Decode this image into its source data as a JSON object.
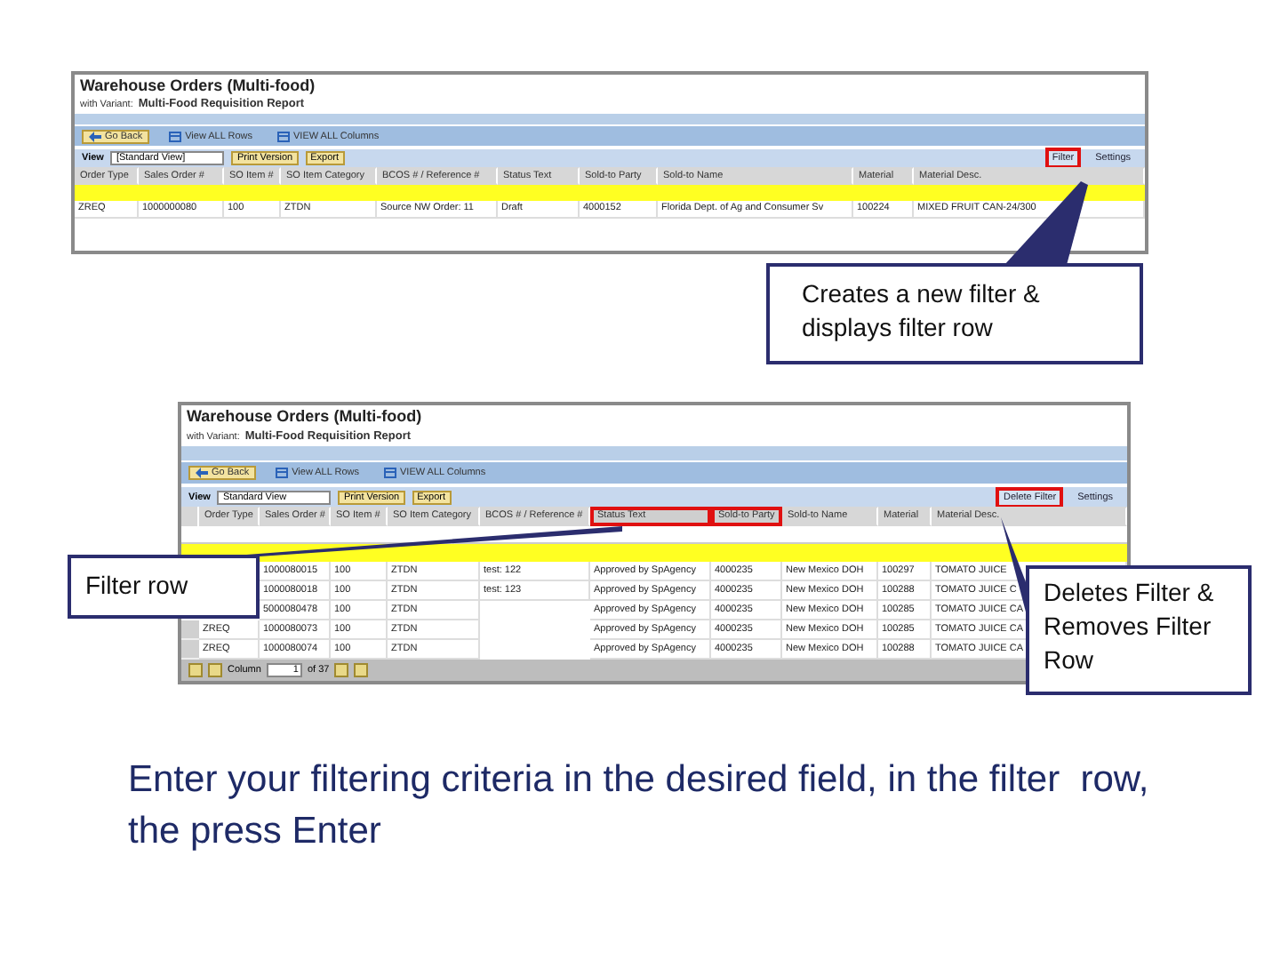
{
  "screenshots": [
    {
      "title": "Warehouse Orders (Multi-food)",
      "variant_label": "with Variant:",
      "variant": "Multi-Food Requisition Report",
      "toolbar": [
        "Go Back",
        "View ALL Rows",
        "VIEW ALL Columns"
      ],
      "view_label": "View",
      "view_value": "[Standard View]",
      "buttons": [
        "Print Version",
        "Export"
      ],
      "links": [
        {
          "label": "Filter",
          "highlighted": true
        },
        {
          "label": "Settings",
          "highlighted": false
        }
      ],
      "filter_row": false,
      "selector_column": false,
      "columns": [
        {
          "label": "Order Type",
          "highlighted": false
        },
        {
          "label": "Sales Order #",
          "highlighted": false
        },
        {
          "label": "SO Item #",
          "highlighted": false
        },
        {
          "label": "SO Item Category",
          "highlighted": false
        },
        {
          "label": "BCOS # / Reference #",
          "highlighted": false
        },
        {
          "label": "Status Text",
          "highlighted": false
        },
        {
          "label": "Sold-to Party",
          "highlighted": false
        },
        {
          "label": "Sold-to Name",
          "highlighted": false
        },
        {
          "label": "Material",
          "highlighted": false
        },
        {
          "label": "Material Desc.",
          "highlighted": false
        }
      ],
      "rows": [
        [
          "ZREQ",
          "1000000080",
          "100",
          "ZTDN",
          "Source NW Order: 11",
          "Draft",
          "4000152",
          "Florida Dept. of Ag and Consumer Sv",
          "100224",
          "MIXED FRUIT CAN-24/300"
        ]
      ]
    },
    {
      "title": "Warehouse Orders (Multi-food)",
      "variant_label": "with Variant:",
      "variant": "Multi-Food Requisition Report",
      "toolbar": [
        "Go Back",
        "View ALL Rows",
        "VIEW ALL Columns"
      ],
      "view_label": "View",
      "view_value": "Standard View",
      "buttons": [
        "Print Version",
        "Export"
      ],
      "links": [
        {
          "label": "Delete Filter",
          "highlighted": true
        },
        {
          "label": "Settings",
          "highlighted": false
        }
      ],
      "filter_row": true,
      "selector_column": true,
      "columns": [
        {
          "label": "Order Type",
          "highlighted": false
        },
        {
          "label": "Sales Order #",
          "highlighted": false
        },
        {
          "label": "SO Item #",
          "highlighted": false
        },
        {
          "label": "SO Item Category",
          "highlighted": false
        },
        {
          "label": "BCOS # / Reference #",
          "highlighted": false
        },
        {
          "label": "Status Text",
          "highlighted": true
        },
        {
          "label": "Sold-to Party",
          "highlighted": true
        },
        {
          "label": "Sold-to Name",
          "highlighted": false
        },
        {
          "label": "Material",
          "highlighted": false
        },
        {
          "label": "Material Desc.",
          "highlighted": false
        }
      ],
      "rows": [
        [
          null,
          "1000080015",
          "100",
          "ZTDN",
          "test: 122",
          "Approved by SpAgency",
          "4000235",
          "New Mexico DOH",
          "100297",
          "TOMATO JUICE"
        ],
        [
          null,
          "1000080018",
          "100",
          "ZTDN",
          "test: 123",
          "Approved by SpAgency",
          "4000235",
          "New Mexico DOH",
          "100288",
          "TOMATO JUICE C"
        ],
        [
          null,
          "5000080478",
          "100",
          "ZTDN",
          null,
          "Approved by SpAgency",
          "4000235",
          "New Mexico DOH",
          "100285",
          "TOMATO JUICE CA"
        ],
        [
          "ZREQ",
          "1000080073",
          "100",
          "ZTDN",
          null,
          "Approved by SpAgency",
          "4000235",
          "New Mexico DOH",
          "100285",
          "TOMATO JUICE CA"
        ],
        [
          "ZREQ",
          "1000080074",
          "100",
          "ZTDN",
          null,
          "Approved by SpAgency",
          "4000235",
          "New Mexico DOH",
          "100288",
          "TOMATO JUICE CA"
        ]
      ],
      "pager": {
        "label": "Column",
        "value": "1",
        "total": "of 37"
      }
    }
  ],
  "callouts": [
    "Creates a new filter & displays filter row",
    "Filter row",
    "Deletes Filter & Removes Filter Row"
  ],
  "instruction": "Enter your filtering criteria in the desired field, in the filter  row, the press Enter"
}
